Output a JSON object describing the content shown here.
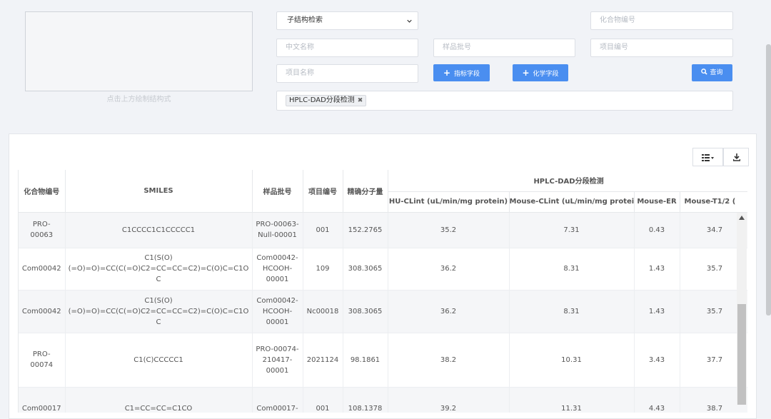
{
  "search": {
    "canvas_hint": "点击上方绘制结构式",
    "mode_select": "子结构检索",
    "compound_id_placeholder": "化合物编号",
    "chinese_name_placeholder": "中文名称",
    "sample_batch_placeholder": "样品批号",
    "project_id_placeholder": "项目编号",
    "project_name_placeholder": "项目名称",
    "indicator_field_label": "指标字段",
    "chem_field_label": "化学字段",
    "query_label": "查询",
    "selected_tag": "HPLC-DAD分段检测"
  },
  "table": {
    "headers": {
      "compound_id": "化合物编号",
      "smiles": "SMILES",
      "sample_batch": "样品批号",
      "project_id": "项目编号",
      "exact_mass": "精确分子量",
      "group": "HPLC-DAD分段检测",
      "hu_clint": "HU-CLint (uL/min/mg protein)",
      "mouse_clint": "Mouse-CLint (uL/min/mg protein)",
      "mouse_er": "Mouse-ER",
      "mouse_t12": "Mouse-T1/2 ("
    },
    "rows": [
      {
        "compound_id": "PRO-00063",
        "smiles": "C1CCCC1C1CCCCC1",
        "sample_batch": "PRO-00063-Null-00001",
        "project_id": "001",
        "exact_mass": "152.2765",
        "hu_clint": "35.2",
        "mouse_clint": "7.31",
        "mouse_er": "0.43",
        "mouse_t12": "34.7"
      },
      {
        "compound_id": "Com00042",
        "smiles": "C1(S(O)(=O)=O)=CC(C(=O)C2=CC=CC=C2)=C(O)C=C1OC",
        "sample_batch": "Com00042-HCOOH-00001",
        "project_id": "109",
        "exact_mass": "308.3065",
        "hu_clint": "36.2",
        "mouse_clint": "8.31",
        "mouse_er": "1.43",
        "mouse_t12": "35.7"
      },
      {
        "compound_id": "Com00042",
        "smiles": "C1(S(O)(=O)=O)=CC(C(=O)C2=CC=CC=C2)=C(O)C=C1OC",
        "sample_batch": "Com00042-HCOOH-00001",
        "project_id": "Nc00018",
        "exact_mass": "308.3065",
        "hu_clint": "36.2",
        "mouse_clint": "8.31",
        "mouse_er": "1.43",
        "mouse_t12": "35.7"
      },
      {
        "compound_id": "PRO-00074",
        "smiles": "C1(C)CCCCC1",
        "sample_batch": "PRO-00074-210417-00001",
        "project_id": "2021124",
        "exact_mass": "98.1861",
        "hu_clint": "38.2",
        "mouse_clint": "10.31",
        "mouse_er": "3.43",
        "mouse_t12": "37.7"
      },
      {
        "compound_id": "Com00017",
        "smiles": "C1=CC=CC=C1CO",
        "sample_batch": "Com00017-",
        "project_id": "001",
        "exact_mass": "108.1378",
        "hu_clint": "39.2",
        "mouse_clint": "11.31",
        "mouse_er": "4.43",
        "mouse_t12": "38.7"
      }
    ]
  }
}
